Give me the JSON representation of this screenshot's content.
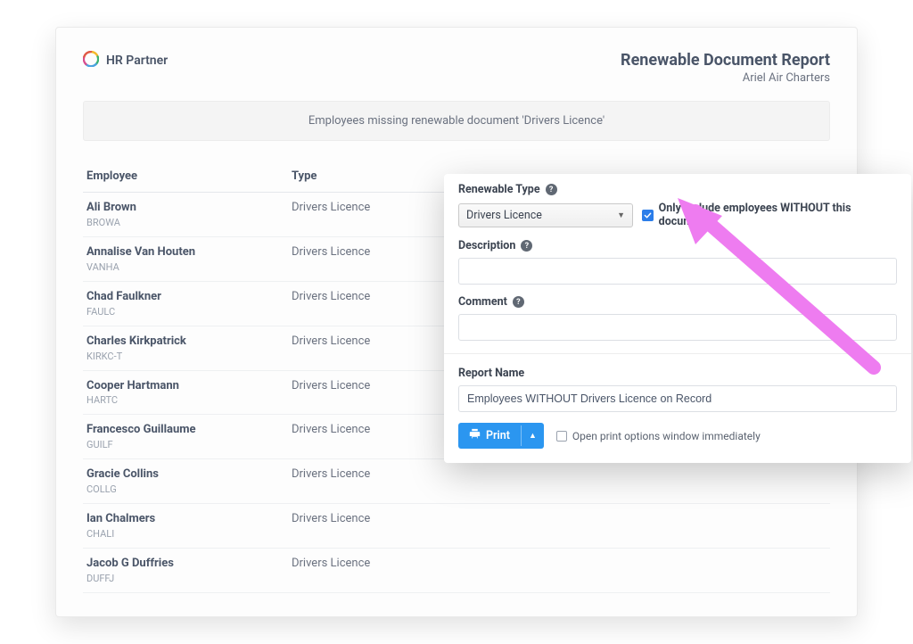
{
  "brand": {
    "name": "HR Partner"
  },
  "report": {
    "title": "Renewable Document Report",
    "company": "Ariel Air Charters",
    "subtitle": "Employees missing renewable document 'Drivers Licence'"
  },
  "table": {
    "headers": {
      "employee": "Employee",
      "type": "Type"
    },
    "rows": [
      {
        "name": "Ali Brown",
        "code": "BROWA",
        "type": "Drivers Licence"
      },
      {
        "name": "Annalise Van Houten",
        "code": "VANHA",
        "type": "Drivers Licence"
      },
      {
        "name": "Chad Faulkner",
        "code": "FAULC",
        "type": "Drivers Licence"
      },
      {
        "name": "Charles Kirkpatrick",
        "code": "KIRKC-T",
        "type": "Drivers Licence"
      },
      {
        "name": "Cooper Hartmann",
        "code": "HARTC",
        "type": "Drivers Licence"
      },
      {
        "name": "Francesco Guillaume",
        "code": "GUILF",
        "type": "Drivers Licence"
      },
      {
        "name": "Gracie Collins",
        "code": "COLLG",
        "type": "Drivers Licence"
      },
      {
        "name": "Ian Chalmers",
        "code": "CHALI",
        "type": "Drivers Licence"
      },
      {
        "name": "Jacob G Duffries",
        "code": "DUFFJ",
        "type": "Drivers Licence"
      }
    ]
  },
  "form": {
    "renewable_type_label": "Renewable Type",
    "renewable_type_value": "Drivers Licence",
    "only_without_label": "Only include employees WITHOUT this document",
    "description_label": "Description",
    "description_value": "",
    "comment_label": "Comment",
    "comment_value": "",
    "report_name_label": "Report Name",
    "report_name_value": "Employees WITHOUT Drivers Licence on Record",
    "print_label": "Print",
    "open_print_label": "Open print options window immediately"
  },
  "icons": {
    "help": "?"
  }
}
